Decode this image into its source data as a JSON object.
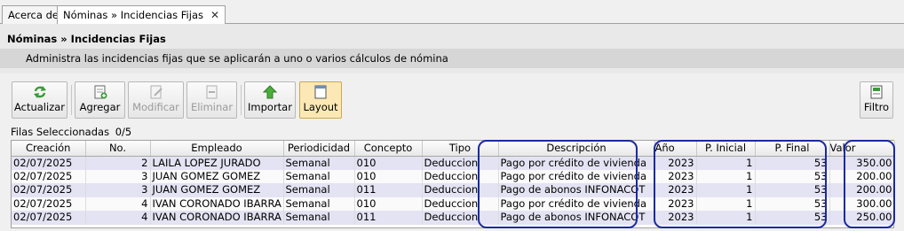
{
  "tabs": [
    {
      "label": "Acerca de"
    },
    {
      "label": "Nóminas » Incidencias Fijas",
      "close": "✕"
    }
  ],
  "header": {
    "title": "Nóminas » Incidencias Fijas",
    "description": "Administra las incidencias fijas que se aplicarán a uno o varios cálculos de nómina"
  },
  "toolbar": {
    "actualizar": "Actualizar",
    "agregar": "Agregar",
    "modificar": "Modificar",
    "eliminar": "Eliminar",
    "importar": "Importar",
    "layout": "Layout",
    "filtro": "Filtro"
  },
  "grid": {
    "selected_label": "Filas Seleccionadas",
    "selected_count": "0/5",
    "columns": [
      "Creación",
      "No.",
      "Empleado",
      "Periodicidad",
      "Concepto",
      "Tipo",
      "Descripción",
      "Año",
      "P. Inicial",
      "P. Final",
      "Valor"
    ],
    "rows": [
      [
        "02/07/2025",
        "2",
        "LAILA LOPEZ JURADO",
        "Semanal",
        "010",
        "Deduccion",
        "Pago por crédito de vivienda",
        "2023",
        "1",
        "53",
        "350.00"
      ],
      [
        "02/07/2025",
        "3",
        "JUAN GOMEZ GOMEZ",
        "Semanal",
        "010",
        "Deduccion",
        "Pago por crédito de vivienda",
        "2023",
        "1",
        "53",
        "200.00"
      ],
      [
        "02/07/2025",
        "3",
        "JUAN GOMEZ GOMEZ",
        "Semanal",
        "011",
        "Deduccion",
        "Pago de abonos INFONACOT",
        "2023",
        "1",
        "53",
        "200.00"
      ],
      [
        "02/07/2025",
        "4",
        "IVAN CORONADO IBARRA",
        "Semanal",
        "010",
        "Deduccion",
        "Pago por crédito de vivienda",
        "2023",
        "1",
        "53",
        "300.00"
      ],
      [
        "02/07/2025",
        "4",
        "IVAN CORONADO IBARRA",
        "Semanal",
        "011",
        "Deduccion",
        "Pago de abonos INFONACOT",
        "2023",
        "1",
        "53",
        "250.00"
      ]
    ]
  },
  "colors": {
    "highlight_ring": "#1a2aa0",
    "row_alt": "#e3e3f3",
    "layout_pressed": "#fbe8b4"
  }
}
